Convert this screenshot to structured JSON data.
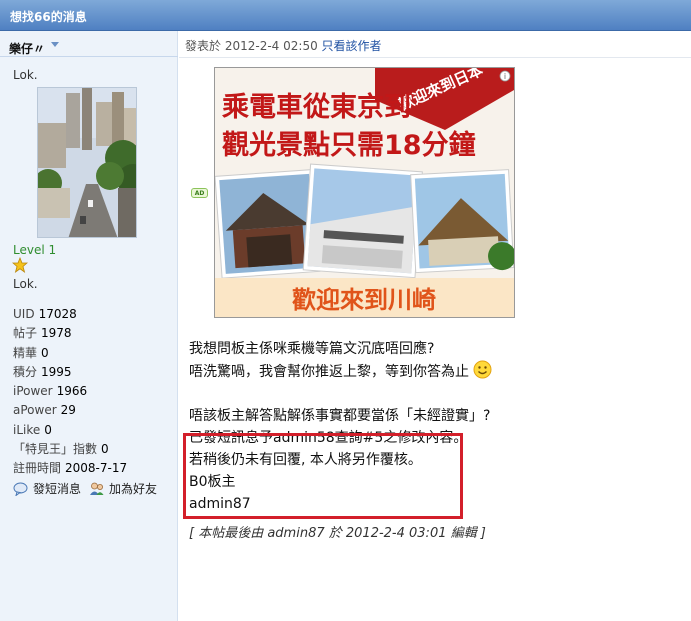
{
  "window": {
    "title": "想找66的消息"
  },
  "author": {
    "name": "樂仔〃",
    "custom_title": "Lok.",
    "level": "Level 1",
    "subtitle": "Lok.",
    "stats": [
      {
        "label": "UID",
        "value": "17028"
      },
      {
        "label": "帖子",
        "value": "1978"
      },
      {
        "label": "精華",
        "value": "0"
      },
      {
        "label": "積分",
        "value": "1995"
      },
      {
        "label": "iPower",
        "value": "1966"
      },
      {
        "label": "aPower",
        "value": "29"
      },
      {
        "label": "iLike",
        "value": "0"
      },
      {
        "label": "「特見王」指數",
        "value": "0"
      },
      {
        "label": "註冊時間",
        "value": "2008-7-17"
      }
    ],
    "actions": {
      "message": "發短消息",
      "add_friend": "加為好友"
    }
  },
  "post": {
    "meta_prefix": "發表於",
    "date": "2012-2-4 02:50",
    "author_only": "只看該作者",
    "ad_badge": "AD",
    "ad": {
      "ribbon": "歡迎來到日本",
      "headline_1": "乘電車從東京到",
      "headline_2": "觀光景點只需18分鐘",
      "bottom": "歡迎來到川崎"
    },
    "lines": [
      "我想問板主係咪乘機等篇文沉底唔回應?",
      "唔洗驚喎，我會幫你推返上黎，等到你答為止",
      "",
      "唔該板主解答點解係事實都要當係「未經證實」?",
      "已發短訊息予admin58查詢#5之修改內容。",
      "若稍後仍未有回覆, 本人將另作覆核。",
      "B0板主",
      "admin87"
    ],
    "edited_note": "[ 本帖最後由 admin87 於 2012-2-4 03:01 編輯 ]"
  },
  "colors": {
    "accent": "#4f80c2",
    "highlight_box": "#d31f2a",
    "level": "#2f8d2f"
  }
}
